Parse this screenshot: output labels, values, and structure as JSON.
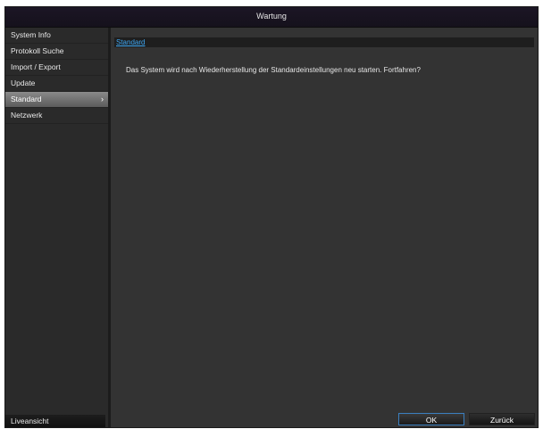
{
  "window": {
    "title": "Wartung"
  },
  "sidebar": {
    "items": [
      {
        "label": "System Info"
      },
      {
        "label": "Protokoll Suche"
      },
      {
        "label": "Import / Export"
      },
      {
        "label": "Update"
      },
      {
        "label": "Standard",
        "selected": true,
        "chevron": "›"
      },
      {
        "label": "Netzwerk"
      }
    ],
    "live_label": "Liveansicht"
  },
  "content": {
    "tab_label": "Standard",
    "message": "Das System wird nach Wiederherstellung der Standardeinstellungen neu starten. Fortfahren?"
  },
  "buttons": {
    "ok_label": "OK",
    "back_label": "Zurück"
  },
  "colors": {
    "accent": "#3fa9f5",
    "selected_item": "#7a7a7a"
  }
}
